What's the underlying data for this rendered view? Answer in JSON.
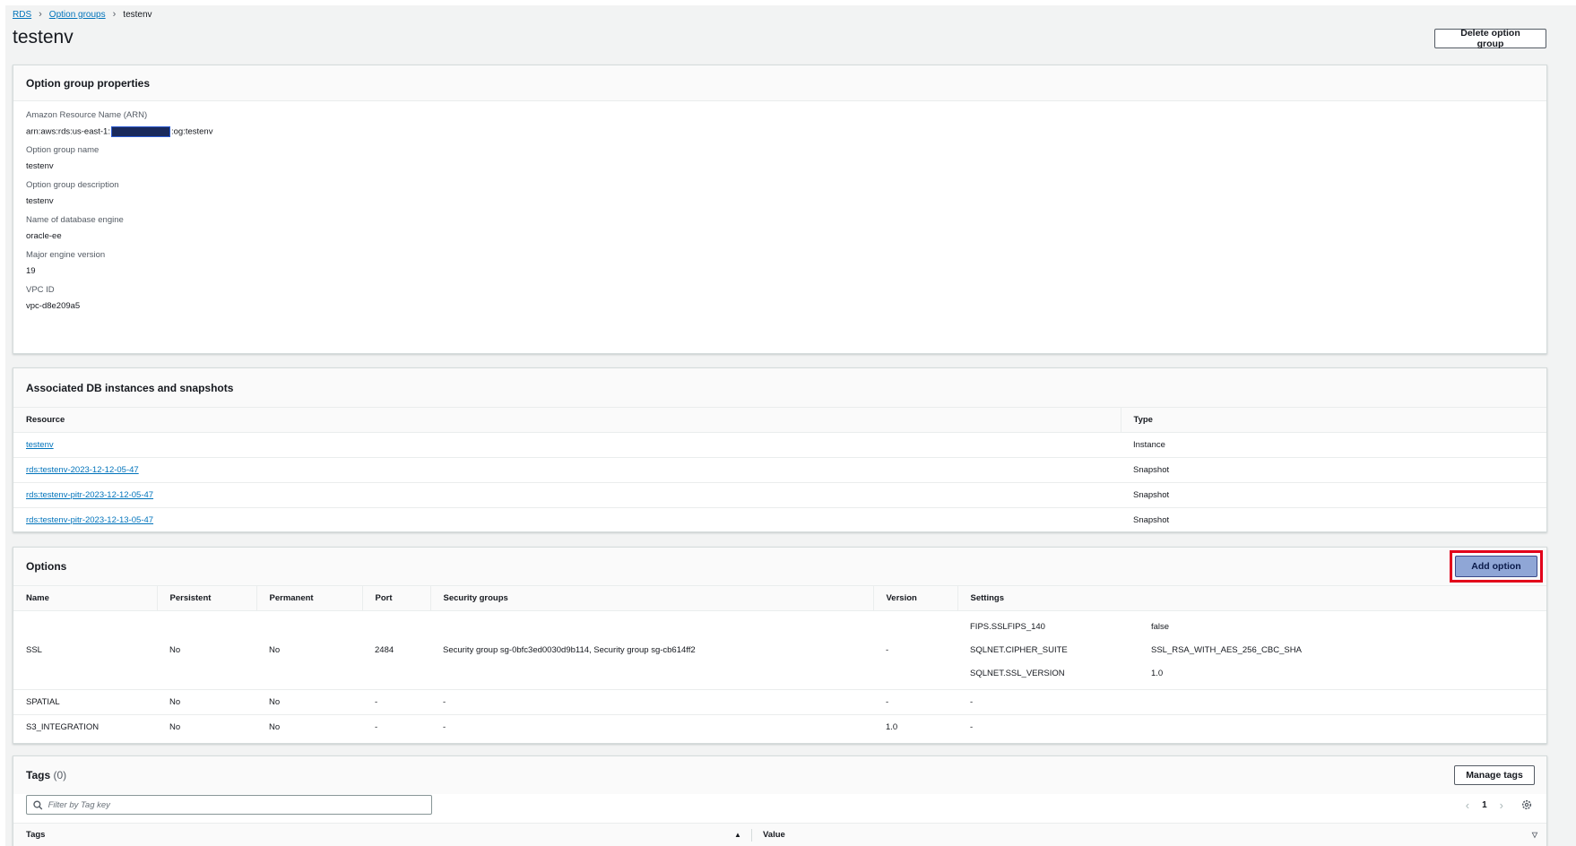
{
  "breadcrumb": {
    "rds": "RDS",
    "option_groups": "Option groups",
    "current": "testenv"
  },
  "page_title": "testenv",
  "delete_button": "Delete option group",
  "properties": {
    "header": "Option group properties",
    "arn_label": "Amazon Resource Name (ARN)",
    "arn_prefix": "arn:aws:rds:us-east-1:",
    "arn_suffix": ":og:testenv",
    "name_label": "Option group name",
    "name_value": "testenv",
    "desc_label": "Option group description",
    "desc_value": "testenv",
    "engine_label": "Name of database engine",
    "engine_value": "oracle-ee",
    "version_label": "Major engine version",
    "version_value": "19",
    "vpc_label": "VPC ID",
    "vpc_value": "vpc-d8e209a5"
  },
  "associated": {
    "header": "Associated DB instances and snapshots",
    "columns": {
      "resource": "Resource",
      "type": "Type"
    },
    "rows": [
      {
        "resource": "testenv",
        "type": "Instance"
      },
      {
        "resource": "rds:testenv-2023-12-12-05-47",
        "type": "Snapshot"
      },
      {
        "resource": "rds:testenv-pitr-2023-12-12-05-47",
        "type": "Snapshot"
      },
      {
        "resource": "rds:testenv-pitr-2023-12-13-05-47",
        "type": "Snapshot"
      }
    ]
  },
  "options": {
    "header": "Options",
    "add_button": "Add option",
    "columns": {
      "name": "Name",
      "persistent": "Persistent",
      "permanent": "Permanent",
      "port": "Port",
      "security_groups": "Security groups",
      "version": "Version",
      "settings": "Settings"
    },
    "rows": [
      {
        "name": "SSL",
        "persistent": "No",
        "permanent": "No",
        "port": "2484",
        "security_groups": "Security group sg-0bfc3ed0030d9b114, Security group sg-cb614ff2",
        "version": "-",
        "settings": [
          {
            "key": "FIPS.SSLFIPS_140",
            "value": "false"
          },
          {
            "key": "SQLNET.CIPHER_SUITE",
            "value": "SSL_RSA_WITH_AES_256_CBC_SHA"
          },
          {
            "key": "SQLNET.SSL_VERSION",
            "value": "1.0"
          }
        ]
      },
      {
        "name": "SPATIAL",
        "persistent": "No",
        "permanent": "No",
        "port": "-",
        "security_groups": "-",
        "version": "-",
        "settings_text": "-"
      },
      {
        "name": "S3_INTEGRATION",
        "persistent": "No",
        "permanent": "No",
        "port": "-",
        "security_groups": "-",
        "version": "1.0",
        "settings_text": "-"
      }
    ]
  },
  "tags": {
    "header": "Tags",
    "count": "(0)",
    "manage_button": "Manage tags",
    "filter_placeholder": "Filter by Tag key",
    "page_number": "1",
    "col_tags": "Tags",
    "col_value": "Value"
  }
}
